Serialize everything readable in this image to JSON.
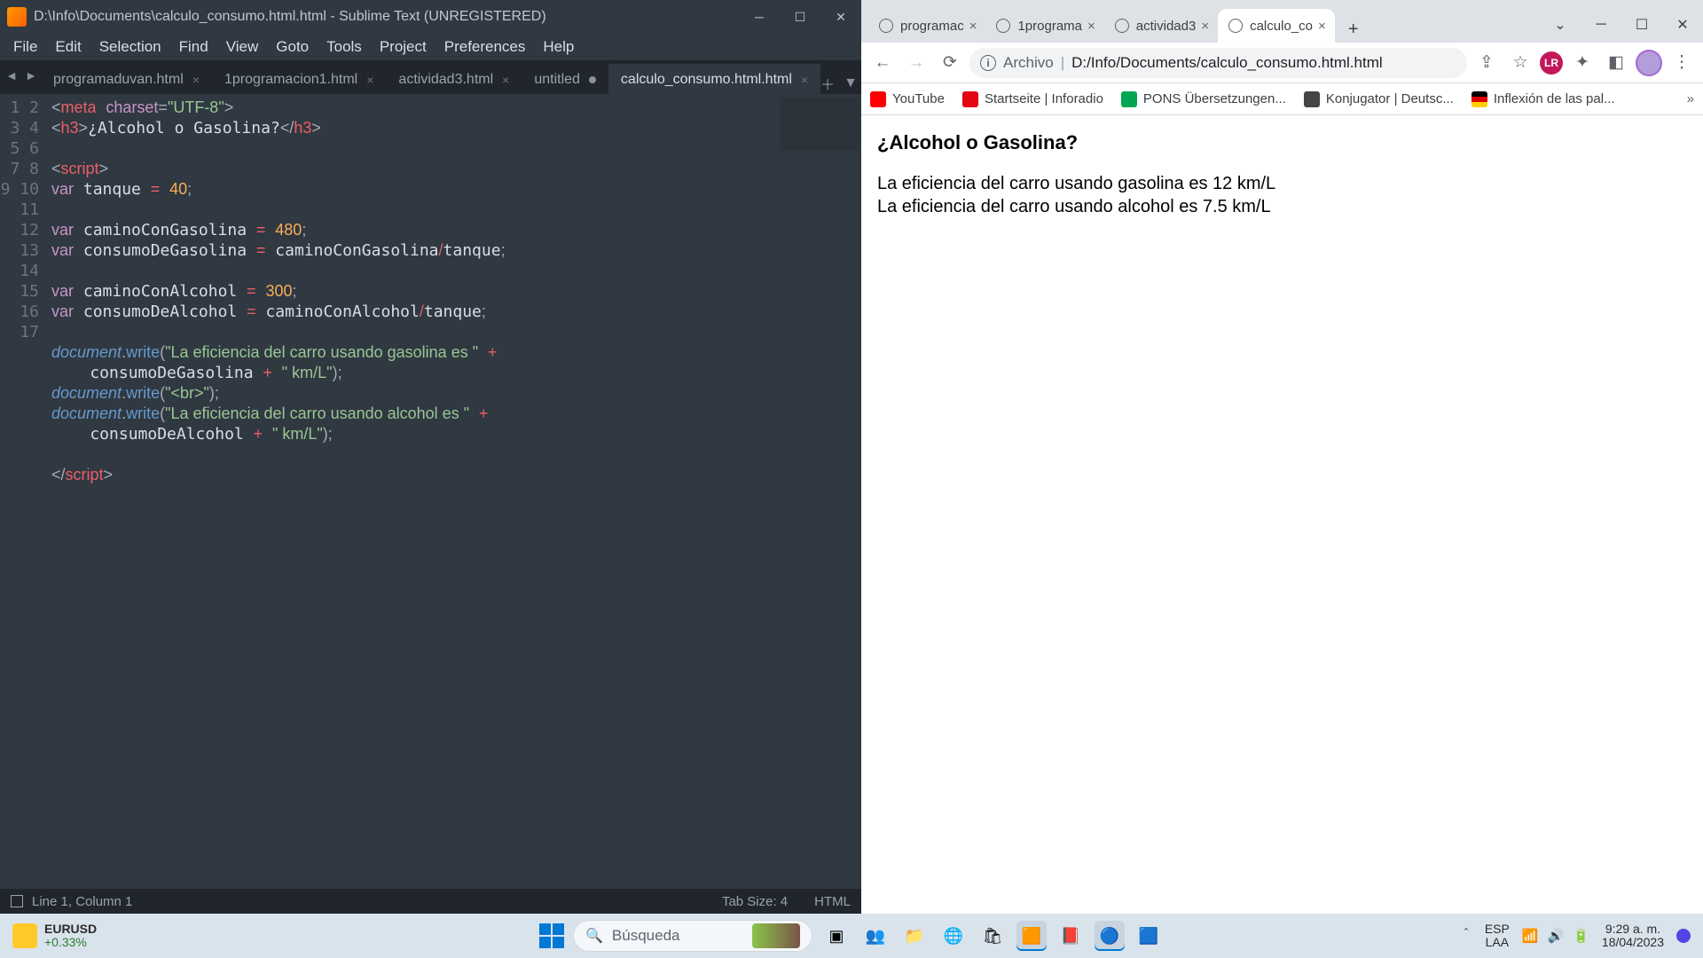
{
  "sublime": {
    "title": "D:\\Info\\Documents\\calculo_consumo.html.html - Sublime Text (UNREGISTERED)",
    "menu": [
      "File",
      "Edit",
      "Selection",
      "Find",
      "View",
      "Goto",
      "Tools",
      "Project",
      "Preferences",
      "Help"
    ],
    "tabs": [
      {
        "label": "programaduvan.html",
        "state": "x"
      },
      {
        "label": "1programacion1.html",
        "state": "x"
      },
      {
        "label": "actividad3.html",
        "state": "x"
      },
      {
        "label": "untitled",
        "state": "dot"
      },
      {
        "label": "calculo_consumo.html.html",
        "state": "x",
        "active": true
      }
    ],
    "lines": 17,
    "status": {
      "pos": "Line 1, Column 1",
      "tab": "Tab Size: 4",
      "lang": "HTML"
    }
  },
  "code": {
    "meta_tag": "meta",
    "charset_attr": "charset",
    "charset_val": "\"UTF-8\"",
    "h3": "h3",
    "h3_text": "¿Alcohol o Gasolina?",
    "script": "script",
    "var": "var",
    "doc": "document",
    "write": "write",
    "tanque": "tanque",
    "tanque_v": "40",
    "camG": "caminoConGasolina",
    "camG_v": "480",
    "consG": "consumoDeGasolina",
    "camA": "caminoConAlcohol",
    "camA_v": "300",
    "consA": "consumoDeAlcohol",
    "s_gas": "\"La eficiencia del carro usando gasolina es \"",
    "s_alc": "\"La eficiencia del carro usando alcohol es \"",
    "s_km": "\" km/L\"",
    "s_br": "\"<br>\""
  },
  "chrome": {
    "tabs": [
      {
        "label": "programac"
      },
      {
        "label": "1programa"
      },
      {
        "label": "actividad3"
      },
      {
        "label": "calculo_co",
        "active": true
      }
    ],
    "omnibox": {
      "scheme": "Archivo",
      "sep": "|",
      "url": "D:/Info/Documents/calculo_consumo.html.html"
    },
    "bookmarks": [
      {
        "label": "YouTube",
        "cls": "yt"
      },
      {
        "label": "Startseite | Inforadio",
        "cls": "rbb"
      },
      {
        "label": "PONS Übersetzungen...",
        "cls": "grn"
      },
      {
        "label": "Konjugator | Deutsc...",
        "cls": "ks"
      },
      {
        "label": "Inflexión de las pal...",
        "cls": "de"
      }
    ],
    "badge": "LR"
  },
  "page": {
    "heading": "¿Alcohol o Gasolina?",
    "l1": "La eficiencia del carro usando gasolina es 12 km/L",
    "l2": "La eficiencia del carro usando alcohol es 7.5 km/L"
  },
  "taskbar": {
    "stock_sym": "EURUSD",
    "stock_chg": "+0.33%",
    "search_placeholder": "Búsqueda",
    "lang1": "ESP",
    "lang2": "LAA",
    "time": "9:29 a. m.",
    "date": "18/04/2023"
  }
}
